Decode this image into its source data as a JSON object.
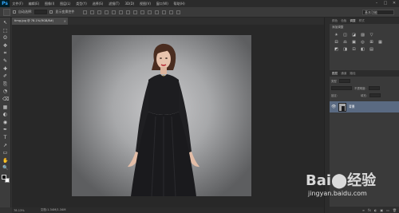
{
  "app": {
    "logo": "Ps"
  },
  "menu": [
    "文件(F)",
    "编辑(E)",
    "图像(I)",
    "图层(L)",
    "类型(Y)",
    "选择(S)",
    "滤镜(T)",
    "3D(D)",
    "视图(V)",
    "窗口(W)",
    "帮助(H)"
  ],
  "window_controls": {
    "minimize": "–",
    "maximize": "□",
    "close": "✕"
  },
  "options": {
    "auto_select_label": "自动选择:",
    "show_transform_label": "显示变换控件",
    "workspace": "基本功能"
  },
  "document": {
    "tab_title": "timg.jpg @ 78.1%(RGB/8#)",
    "close": "×",
    "zoom": "78.13%",
    "doc_info": "文档:1.34M/1.34M"
  },
  "tools": [
    "↖",
    "⬚",
    "ʘ",
    "✥",
    "⌗",
    "✎",
    "✚",
    "✐",
    "⎘",
    "◔",
    "⌫",
    "▦",
    "◐",
    "◉",
    "✒",
    "T",
    "↗",
    "▭",
    "✋",
    "🔍"
  ],
  "panels": {
    "top_tabs": [
      "颜色",
      "色板",
      "调整",
      "样式"
    ],
    "adjust_title": "添加调整",
    "adjust_icons_row1": [
      "☀",
      "◫",
      "◪",
      "▨",
      "▽"
    ],
    "adjust_icons_row2": [
      "⊟",
      "⚖",
      "▣",
      "◎",
      "⊞",
      "▦"
    ],
    "adjust_icons_row3": [
      "◩",
      "◨",
      "⊡",
      "◧",
      "▤"
    ],
    "layers_tabs": [
      "图层",
      "通道",
      "路径"
    ],
    "kind_label": "类型",
    "mode_label": "正常",
    "opacity_label": "不透明度:",
    "lock_label": "锁定:",
    "fill_label": "填充:",
    "layer_name": "背景",
    "eye": "👁",
    "footer_icons": [
      "∞",
      "fx",
      "◐",
      "▣",
      "▭",
      "🗑"
    ]
  },
  "watermark": {
    "logo": "Bai⬤经验",
    "url": "jingyan.baidu.com"
  }
}
